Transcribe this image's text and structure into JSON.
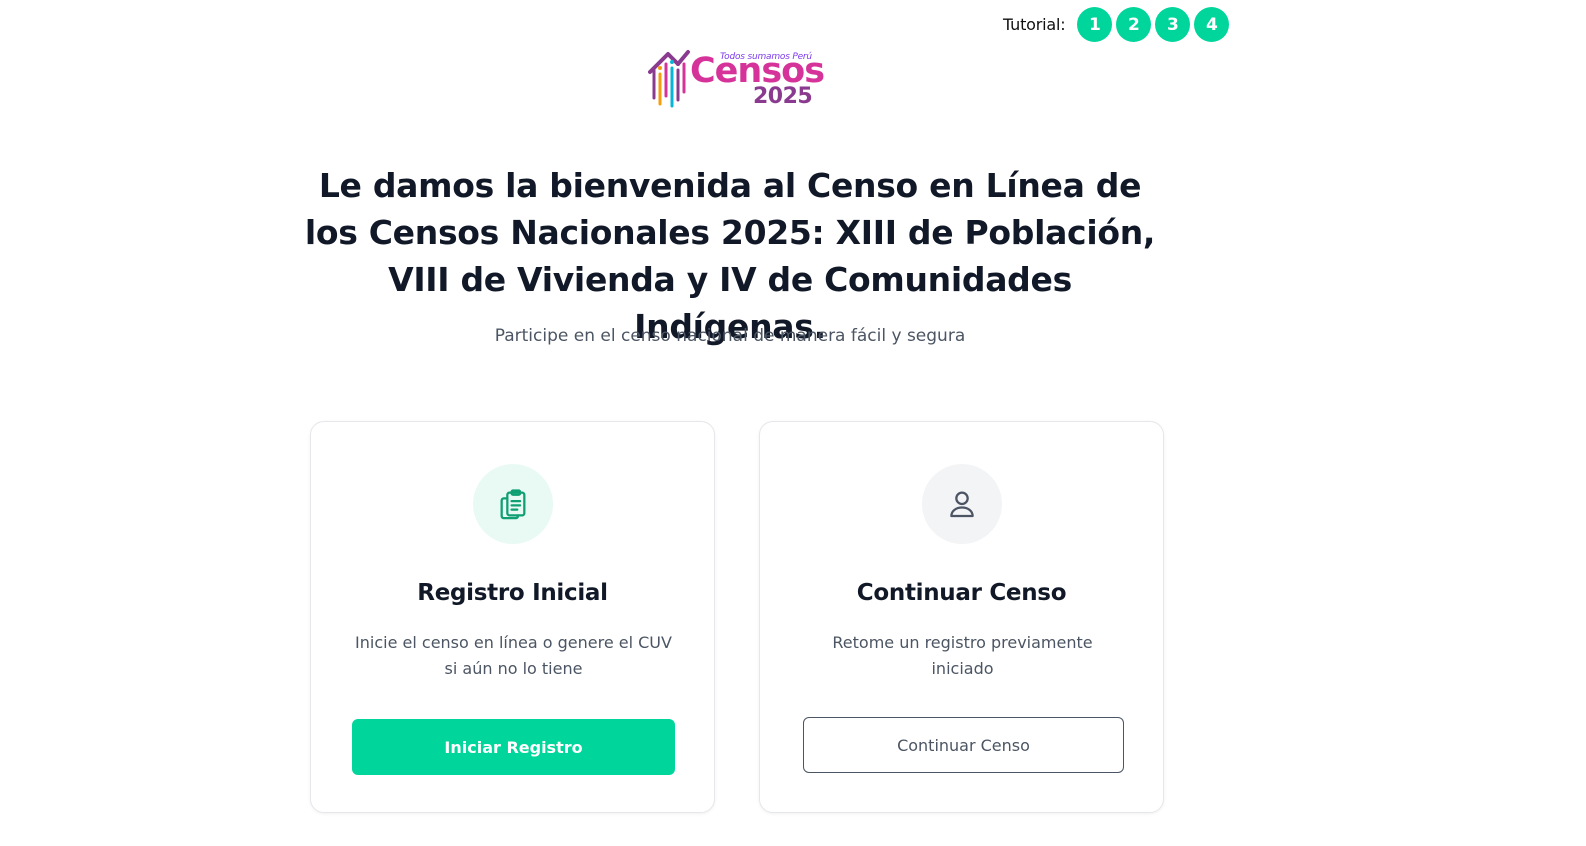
{
  "tutorial": {
    "label": "Tutorial:",
    "steps": [
      "1",
      "2",
      "3",
      "4"
    ]
  },
  "logo": {
    "tagline": "Todos sumamos Perú",
    "word": "Censos",
    "year": "2025"
  },
  "welcome": {
    "title": "Le damos la bienvenida al Censo en Línea de los Censos Nacionales 2025: XIII de Población, VIII de Vivienda y IV de Comunidades Indígenas.",
    "subtitle": "Participe en el censo nacional de manera fácil y segura"
  },
  "cards": {
    "registro": {
      "icon": "clipboard-copy-icon",
      "title": "Registro Inicial",
      "description": "Inicie el censo en línea o genere el CUV si aún no lo tiene",
      "button_label": "Iniciar Registro"
    },
    "continuar": {
      "icon": "user-icon",
      "title": "Continuar Censo",
      "description": "Retome un registro previamente iniciado",
      "button_label": "Continuar Censo"
    }
  },
  "colors": {
    "accent": "#00d69c",
    "heading": "#111827",
    "muted": "#4b5563",
    "logo_magenta": "#d6339a",
    "logo_purple": "#8a3b8f"
  }
}
